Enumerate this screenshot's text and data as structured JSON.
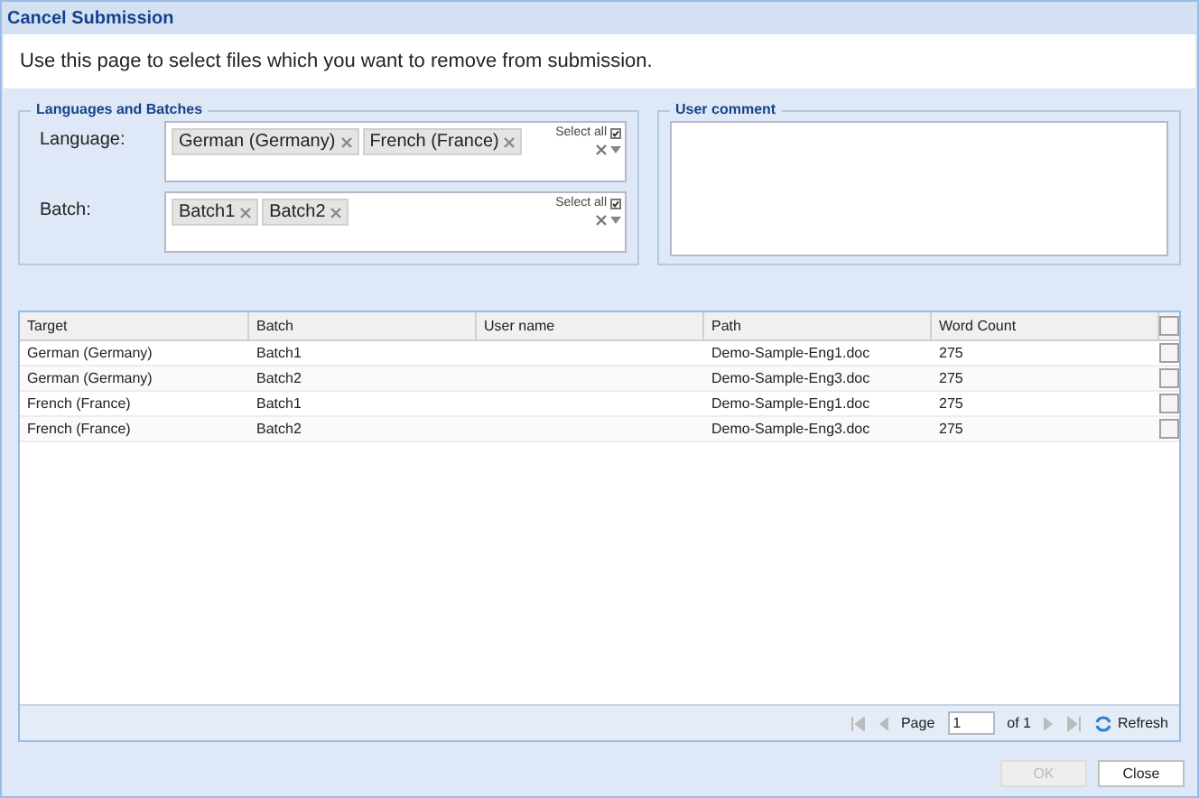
{
  "window": {
    "title": "Cancel Submission"
  },
  "intro": "Use this page to select files which you want to remove from submission.",
  "languages_and_batches": {
    "legend": "Languages and Batches",
    "fields": [
      {
        "label": "Language:",
        "tags": [
          "German (Germany)",
          "French (France)"
        ],
        "select_all": "Select all"
      },
      {
        "label": "Batch:",
        "tags": [
          "Batch1",
          "Batch2"
        ],
        "select_all": "Select all"
      }
    ]
  },
  "user_comment": {
    "legend": "User comment"
  },
  "table": {
    "columns": [
      "Target",
      "Batch",
      "User name",
      "Path",
      "Word Count"
    ],
    "header_checked": false,
    "rows": [
      {
        "cells": [
          "German (Germany)",
          "Batch1",
          "",
          "Demo-Sample-Eng1.doc",
          "275"
        ],
        "checked": false
      },
      {
        "cells": [
          "German (Germany)",
          "Batch2",
          "",
          "Demo-Sample-Eng3.doc",
          "275"
        ],
        "checked": false
      },
      {
        "cells": [
          "French (France)",
          "Batch1",
          "",
          "Demo-Sample-Eng1.doc",
          "275"
        ],
        "checked": false
      },
      {
        "cells": [
          "French (France)",
          "Batch2",
          "",
          "Demo-Sample-Eng3.doc",
          "275"
        ],
        "checked": false
      }
    ]
  },
  "pager": {
    "page_label": "Page",
    "page": "1",
    "of": "of 1",
    "refresh": "Refresh"
  },
  "buttons": [
    {
      "label": "OK",
      "disabled": true
    },
    {
      "label": "Close",
      "disabled": false
    }
  ]
}
